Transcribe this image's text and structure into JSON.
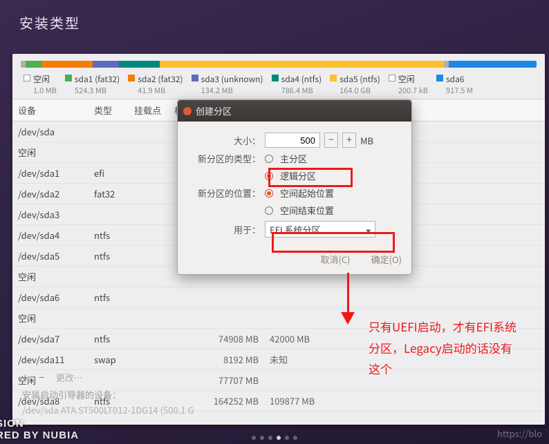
{
  "title": "安装类型",
  "legend": [
    {
      "name": "空闲",
      "size": "1.0 MB",
      "color": "sq"
    },
    {
      "name": "sda1 (fat32)",
      "size": "524.3 MB",
      "color": "seg-green"
    },
    {
      "name": "sda2 (fat32)",
      "size": "41.9 MB",
      "color": "seg-orange"
    },
    {
      "name": "sda3 (unknown)",
      "size": "134.2 MB",
      "color": "seg-purple"
    },
    {
      "name": "sda4 (ntfs)",
      "size": "786.4 MB",
      "color": "seg-teal"
    },
    {
      "name": "sda5 (ntfs)",
      "size": "164.0 GB",
      "color": "seg-yellow"
    },
    {
      "name": "空闲",
      "size": "200.7 kB",
      "color": "sq"
    },
    {
      "name": "sda6",
      "size": "917.5 M",
      "color": "seg-blue"
    }
  ],
  "columns": {
    "dev": "设备",
    "type": "类型",
    "mount": "挂载点",
    "format": "格",
    "size": "",
    "used": ""
  },
  "rows": [
    {
      "dev": "/dev/sda",
      "type": "",
      "size": "",
      "used": ""
    },
    {
      "dev": "空闲",
      "type": "",
      "size": "",
      "used": ""
    },
    {
      "dev": "/dev/sda1",
      "type": "efi",
      "size": "",
      "used": ""
    },
    {
      "dev": "/dev/sda2",
      "type": "fat32",
      "size": "",
      "used": ""
    },
    {
      "dev": "/dev/sda3",
      "type": "",
      "size": "",
      "used": ""
    },
    {
      "dev": "/dev/sda4",
      "type": "ntfs",
      "size": "",
      "used": ""
    },
    {
      "dev": "/dev/sda5",
      "type": "ntfs",
      "size": "",
      "used": ""
    },
    {
      "dev": "空闲",
      "type": "",
      "size": "",
      "used": ""
    },
    {
      "dev": "/dev/sda6",
      "type": "ntfs",
      "size": "",
      "used": ""
    },
    {
      "dev": "空闲",
      "type": "",
      "size": "",
      "used": ""
    },
    {
      "dev": "/dev/sda7",
      "type": "ntfs",
      "size": "74908 MB",
      "used": "42000 MB"
    },
    {
      "dev": "/dev/sda11",
      "type": "swap",
      "size": "8192 MB",
      "used": "未知"
    },
    {
      "dev": "空闲",
      "type": "",
      "size": "77707 MB",
      "used": ""
    },
    {
      "dev": "/dev/sda8",
      "type": "ntfs",
      "size": "164252 MB",
      "used": "109877 MB"
    }
  ],
  "toolbar": {
    "plus": "+",
    "minus": "−",
    "change": "更改…"
  },
  "bootlabel": "安装启动引导器的设备：",
  "bootvalue": "/dev/sda    ATA ST500LT012-1DG14 (500.1 G",
  "dialog": {
    "title": "创建分区",
    "size_label": "大小：",
    "size_value": "500",
    "size_unit": "MB",
    "type_label": "新分区的类型：",
    "type_primary": "主分区",
    "type_logical": "逻辑分区",
    "loc_label": "新分区的位置：",
    "loc_begin": "空间起始位置",
    "loc_end": "空间结束位置",
    "use_label": "用于：",
    "use_value": "EFI 系统分区",
    "cancel": "取消(C)",
    "ok": "确定(O)"
  },
  "annotation": "只有UEFI启动，才有EFI系统分区，Legacy启动的话没有这个",
  "watermark_left_l1": "SION",
  "watermark_left_l2": "RED BY NUBIA",
  "watermark_right": "https://blo"
}
